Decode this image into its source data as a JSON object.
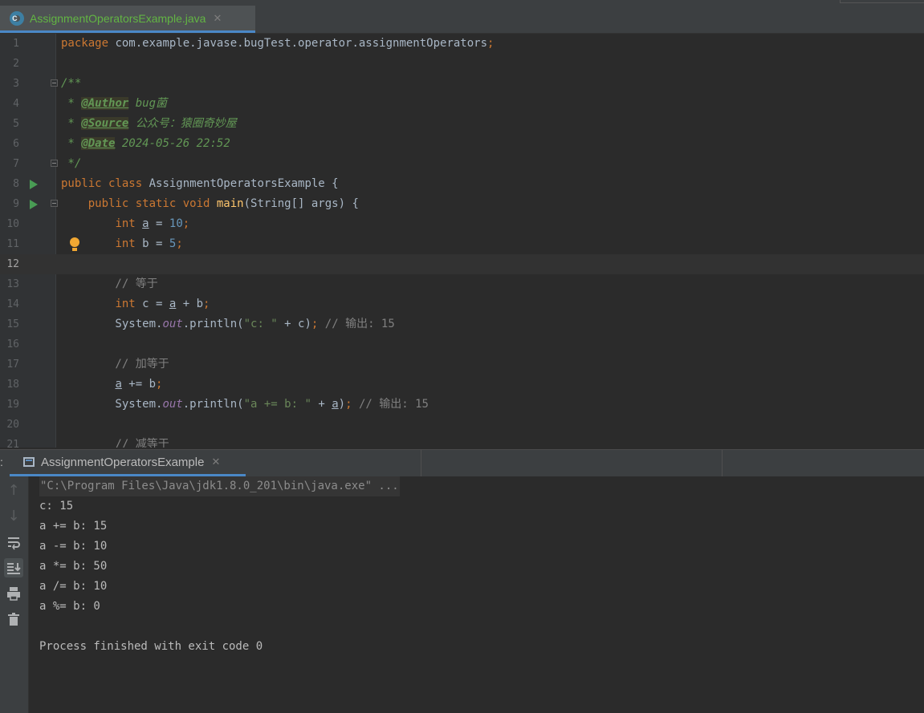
{
  "editor_tab": {
    "filename": "AssignmentOperatorsExample.java",
    "close": "✕"
  },
  "code_lines": [
    "package com.example.javase.bugTest.operator.assignmentOperators;",
    "",
    "/**",
    " * @Author bug菌",
    " * @Source 公众号：猿圈奇妙屋",
    " * @Date 2024-05-26 22:52",
    " */",
    "public class AssignmentOperatorsExample {",
    "    public static void main(String[] args) {",
    "        int a = 10;",
    "        int b = 5;",
    "",
    "        // 等于",
    "        int c = a + b;",
    "        System.out.println(\"c: \" + c); // 输出: 15",
    "",
    "        // 加等于",
    "        a += b;",
    "        System.out.println(\"a += b: \" + a); // 输出: 15",
    "",
    "        // 减等于"
  ],
  "line_numbers": [
    "1",
    "2",
    "3",
    "4",
    "5",
    "6",
    "7",
    "8",
    "9",
    "10",
    "11",
    "12",
    "13",
    "14",
    "15",
    "16",
    "17",
    "18",
    "19",
    "20",
    "21"
  ],
  "current_line": "12",
  "run_panel": {
    "label": ":",
    "tab_name": "AssignmentOperatorsExample",
    "close": "✕",
    "toolbar_icons": [
      "arrow-up-icon",
      "arrow-down-icon",
      "soft-wrap-icon",
      "scroll-to-end-icon",
      "print-icon",
      "trash-icon"
    ]
  },
  "console_output": [
    "\"C:\\Program Files\\Java\\jdk1.8.0_201\\bin\\java.exe\" ...",
    "c: 15",
    "a += b: 15",
    "a -= b: 10",
    "a *= b: 50",
    "a /= b: 10",
    "a %= b: 0",
    "",
    "Process finished with exit code 0"
  ],
  "colors": {
    "accent": "#4a88c7",
    "run_green": "#499c54",
    "bulb": "#f0a732",
    "tab_filename": "#62b543"
  }
}
